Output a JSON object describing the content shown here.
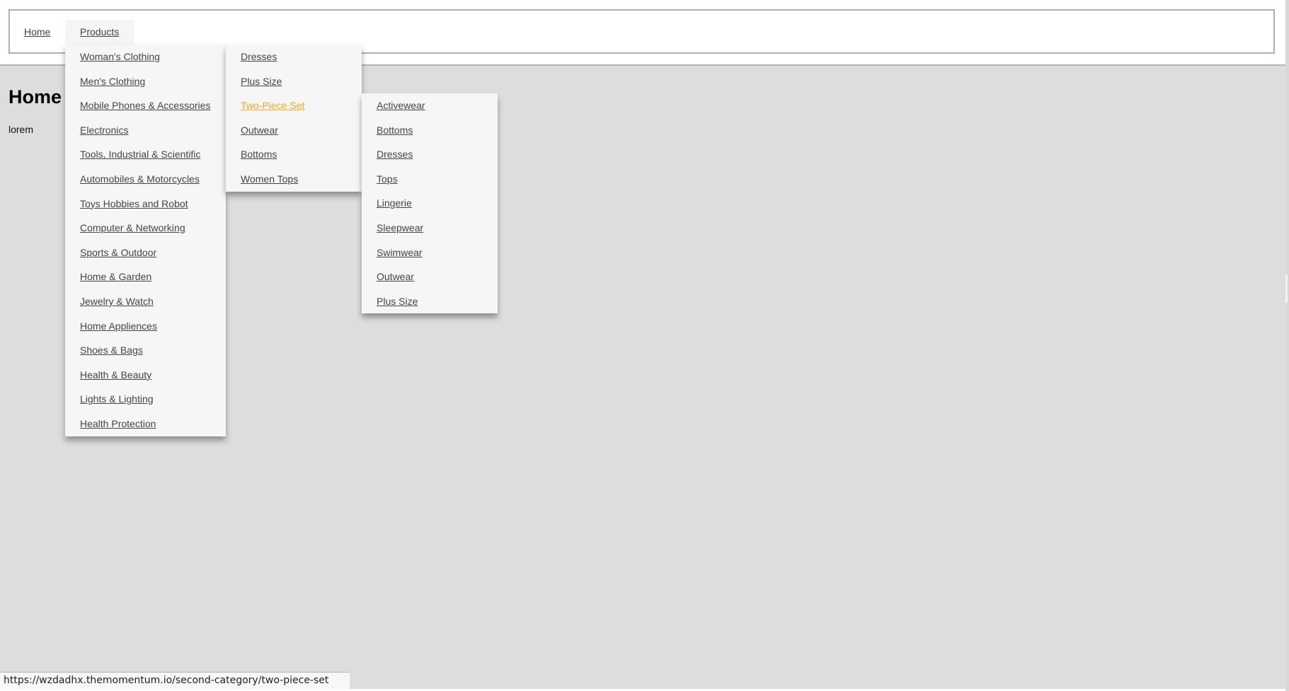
{
  "nav": {
    "home_label": "Home",
    "products_label": "Products"
  },
  "content": {
    "title": "Home",
    "text": "lorem"
  },
  "menus": {
    "categories": [
      {
        "label": "Woman's Clothing"
      },
      {
        "label": "Men's Clothing"
      },
      {
        "label": "Mobile Phones & Accessories"
      },
      {
        "label": "Electronics"
      },
      {
        "label": "Tools, Industrial & Scientific"
      },
      {
        "label": "Automobiles & Motorcycles"
      },
      {
        "label": "Toys Hobbies and Robot"
      },
      {
        "label": "Computer & Networking"
      },
      {
        "label": "Sports & Outdoor"
      },
      {
        "label": "Home & Garden"
      },
      {
        "label": "Jewelry & Watch"
      },
      {
        "label": "Home Appliences"
      },
      {
        "label": "Shoes & Bags"
      },
      {
        "label": "Health & Beauty"
      },
      {
        "label": "Lights & Lighting"
      },
      {
        "label": "Health Protection"
      }
    ],
    "womens_subcategories": [
      {
        "label": "Dresses"
      },
      {
        "label": "Plus Size"
      },
      {
        "label": "Two-Piece Set",
        "active": true
      },
      {
        "label": "Outwear"
      },
      {
        "label": "Bottoms"
      },
      {
        "label": "Women Tops"
      }
    ],
    "two_piece_subcategories": [
      {
        "label": "Activewear"
      },
      {
        "label": "Bottoms"
      },
      {
        "label": "Dresses"
      },
      {
        "label": "Tops"
      },
      {
        "label": "Lingerie"
      },
      {
        "label": "Sleepwear"
      },
      {
        "label": "Swimwear"
      },
      {
        "label": "Outwear"
      },
      {
        "label": "Plus Size"
      }
    ]
  },
  "status_bar": {
    "url": "https://wzdadhx.themomentum.io/second-category/two-piece-set"
  },
  "colors": {
    "link": "#444444",
    "active_link": "#f5a623",
    "menu_bg": "#f6f6f6",
    "page_bg": "#dddddd"
  }
}
